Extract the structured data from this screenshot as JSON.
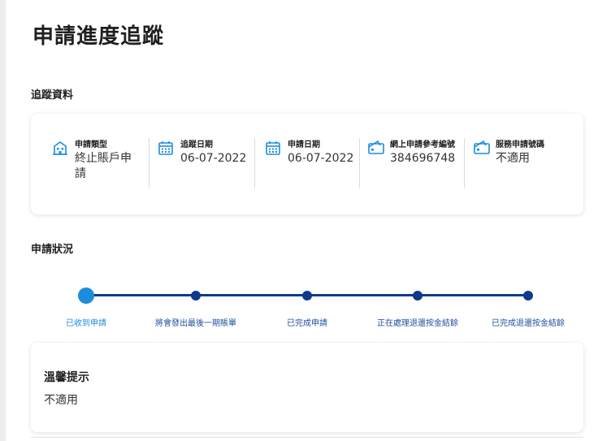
{
  "page": {
    "title": "申請進度追蹤"
  },
  "tracking": {
    "section_title": "追蹤資料",
    "items": [
      {
        "icon": "building-icon",
        "label": "申請類型",
        "value": "終止賬戶申請"
      },
      {
        "icon": "calendar-icon",
        "label": "追蹤日期",
        "value": "06-07-2022"
      },
      {
        "icon": "calendar-icon",
        "label": "申請日期",
        "value": "06-07-2022"
      },
      {
        "icon": "ticket-icon",
        "label": "網上申請參考編號",
        "value": "384696748"
      },
      {
        "icon": "ticket-icon",
        "label": "服務申請號碼",
        "value": "不適用"
      }
    ]
  },
  "status": {
    "section_title": "申請狀況",
    "current_step": 0,
    "steps": [
      "已收到申請",
      "將會發出最後一期賬單",
      "已完成申請",
      "正在處理退還按金結餘",
      "已完成退還按金結餘"
    ]
  },
  "notice": {
    "title": "溫馨提示",
    "value": "不適用"
  },
  "colors": {
    "accent": "#1c8ddd",
    "track": "#0d3a8a",
    "step_text": "#1f4fa0",
    "divider": "#d6dce6"
  }
}
